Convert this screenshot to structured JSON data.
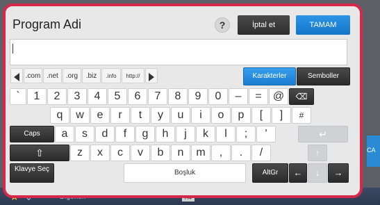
{
  "background": {
    "bottom_other_label": "Diğerleri",
    "bottom_a4": "A4",
    "right_edge_label": "CA"
  },
  "dialog": {
    "title": "Program Adi",
    "help_label": "?",
    "cancel_label": "İptal et",
    "ok_label": "TAMAM",
    "input_value": ""
  },
  "domain_row": {
    "items": [
      ".com",
      ".net",
      ".org",
      ".biz",
      ".info",
      "http://"
    ],
    "characters_tab": "Karakterler",
    "symbols_tab": "Semboller"
  },
  "keyboard": {
    "row1": [
      "`",
      "1",
      "2",
      "3",
      "4",
      "5",
      "6",
      "7",
      "8",
      "9",
      "0",
      "–",
      "=",
      "@"
    ],
    "row2": [
      "q",
      "w",
      "e",
      "r",
      "t",
      "y",
      "u",
      "i",
      "o",
      "p",
      "[",
      "]",
      "#"
    ],
    "row3": [
      "a",
      "s",
      "d",
      "f",
      "g",
      "h",
      "j",
      "k",
      "l",
      ";",
      "'"
    ],
    "row4": [
      "z",
      "x",
      "c",
      "v",
      "b",
      "n",
      "m",
      ",",
      ".",
      "/"
    ],
    "caps_label": "Caps",
    "keyboard_select_label": "Klavye Seç",
    "space_label": "Boşluk",
    "altgr_label": "AltGr"
  },
  "colors": {
    "frame_border": "#d6284b",
    "ok_button": "#1e84d8",
    "dark_button": "#333333"
  }
}
